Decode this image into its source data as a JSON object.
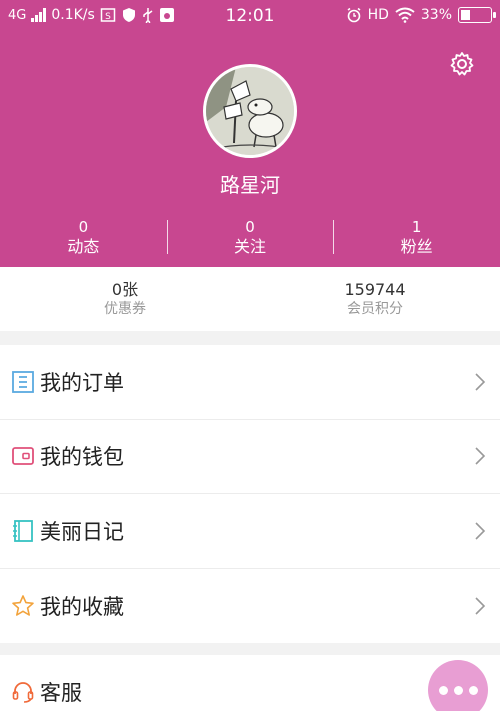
{
  "status_bar": {
    "network": "4G",
    "speed": "0.1K/s",
    "time": "12:01",
    "hd": "HD",
    "battery": "33%"
  },
  "profile": {
    "username": "路星河"
  },
  "stats": [
    {
      "value": "0",
      "label": "动态"
    },
    {
      "value": "0",
      "label": "关注"
    },
    {
      "value": "1",
      "label": "粉丝"
    }
  ],
  "account": {
    "coupon_value": "0张",
    "coupon_label": "优惠券",
    "points_value": "159744",
    "points_label": "会员积分"
  },
  "menu_primary": [
    {
      "label": "我的订单",
      "icon": "order-list-icon",
      "color": "#5aa9e0"
    },
    {
      "label": "我的钱包",
      "icon": "wallet-icon",
      "color": "#e0507a"
    },
    {
      "label": "美丽日记",
      "icon": "notebook-icon",
      "color": "#36c2c2"
    },
    {
      "label": "我的收藏",
      "icon": "star-icon",
      "color": "#f2a33c"
    }
  ],
  "menu_secondary": [
    {
      "label": "客服",
      "icon": "headset-icon",
      "color": "#f06a3a"
    }
  ],
  "colors": {
    "header_bg": "#c84790",
    "fab_bg": "#e89ed3"
  }
}
